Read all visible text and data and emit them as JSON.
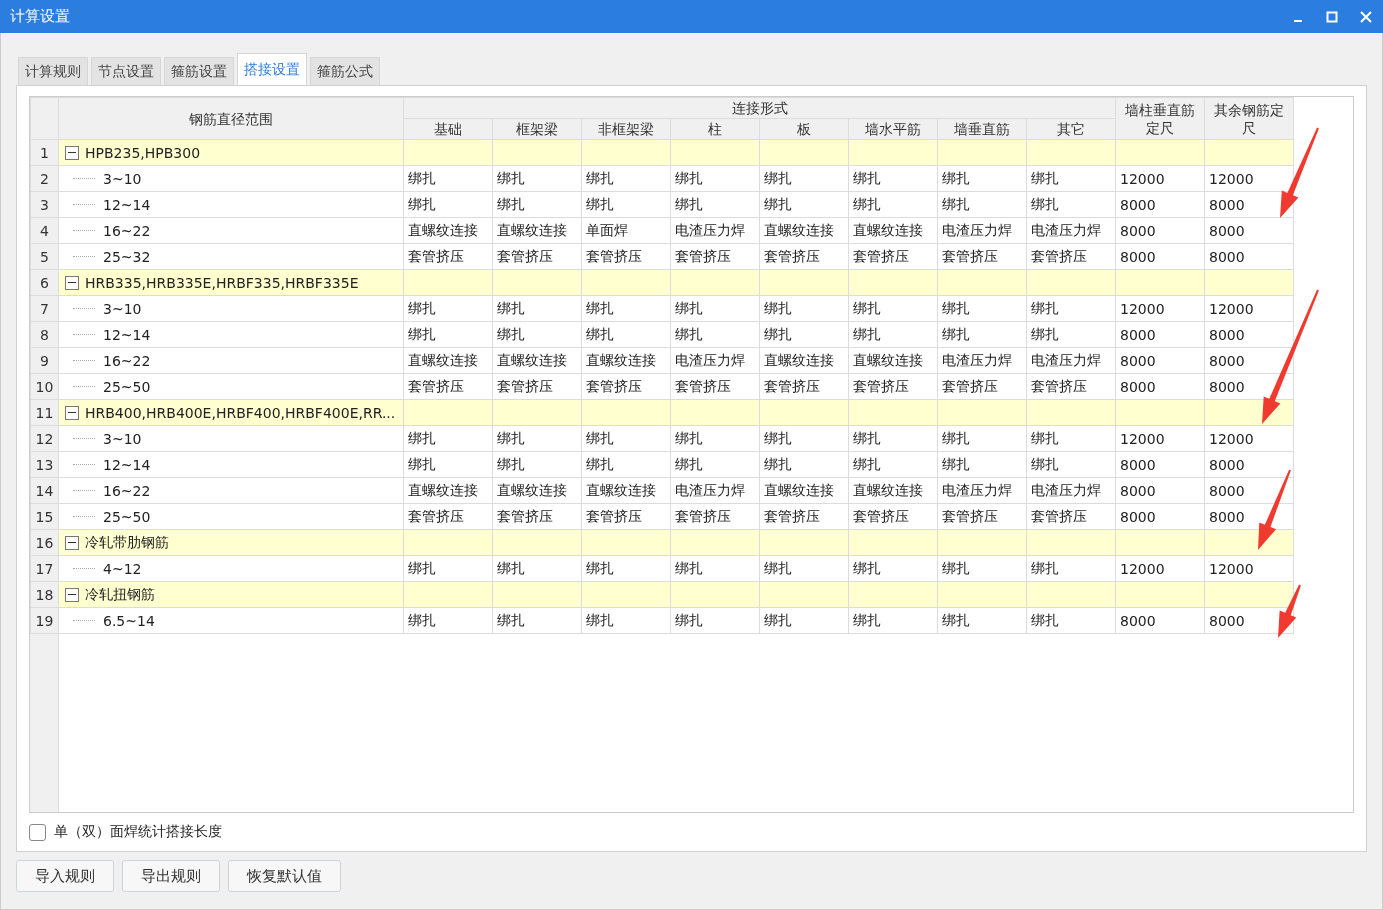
{
  "window": {
    "title": "计算设置"
  },
  "tabs": [
    {
      "label": "计算规则",
      "selected": false
    },
    {
      "label": "节点设置",
      "selected": false
    },
    {
      "label": "箍筋设置",
      "selected": false
    },
    {
      "label": "搭接设置",
      "selected": true
    },
    {
      "label": "箍筋公式",
      "selected": false
    }
  ],
  "table": {
    "range_header": "钢筋直径范围",
    "group_header": "连接形式",
    "columns": [
      "基础",
      "框架梁",
      "非框架梁",
      "柱",
      "板",
      "墙水平筋",
      "墙垂直筋",
      "其它"
    ],
    "length_columns": [
      [
        "墙柱垂直筋",
        "定尺"
      ],
      [
        "其余钢筋定",
        "尺"
      ]
    ],
    "groups": [
      {
        "number": "1",
        "label": "HPB235,HPB300",
        "expanded": true,
        "children": [
          {
            "number": "2",
            "label": "3~10",
            "cells": [
              "绑扎",
              "绑扎",
              "绑扎",
              "绑扎",
              "绑扎",
              "绑扎",
              "绑扎",
              "绑扎",
              "12000",
              "12000"
            ]
          },
          {
            "number": "3",
            "label": "12~14",
            "cells": [
              "绑扎",
              "绑扎",
              "绑扎",
              "绑扎",
              "绑扎",
              "绑扎",
              "绑扎",
              "绑扎",
              "8000",
              "8000"
            ]
          },
          {
            "number": "4",
            "label": "16~22",
            "cells": [
              "直螺纹连接",
              "直螺纹连接",
              "单面焊",
              "电渣压力焊",
              "直螺纹连接",
              "直螺纹连接",
              "电渣压力焊",
              "电渣压力焊",
              "8000",
              "8000"
            ]
          },
          {
            "number": "5",
            "label": "25~32",
            "cells": [
              "套管挤压",
              "套管挤压",
              "套管挤压",
              "套管挤压",
              "套管挤压",
              "套管挤压",
              "套管挤压",
              "套管挤压",
              "8000",
              "8000"
            ]
          }
        ]
      },
      {
        "number": "6",
        "label": "HRB335,HRB335E,HRBF335,HRBF335E",
        "expanded": true,
        "children": [
          {
            "number": "7",
            "label": "3~10",
            "cells": [
              "绑扎",
              "绑扎",
              "绑扎",
              "绑扎",
              "绑扎",
              "绑扎",
              "绑扎",
              "绑扎",
              "12000",
              "12000"
            ]
          },
          {
            "number": "8",
            "label": "12~14",
            "cells": [
              "绑扎",
              "绑扎",
              "绑扎",
              "绑扎",
              "绑扎",
              "绑扎",
              "绑扎",
              "绑扎",
              "8000",
              "8000"
            ]
          },
          {
            "number": "9",
            "label": "16~22",
            "cells": [
              "直螺纹连接",
              "直螺纹连接",
              "直螺纹连接",
              "电渣压力焊",
              "直螺纹连接",
              "直螺纹连接",
              "电渣压力焊",
              "电渣压力焊",
              "8000",
              "8000"
            ]
          },
          {
            "number": "10",
            "label": "25~50",
            "cells": [
              "套管挤压",
              "套管挤压",
              "套管挤压",
              "套管挤压",
              "套管挤压",
              "套管挤压",
              "套管挤压",
              "套管挤压",
              "8000",
              "8000"
            ]
          }
        ]
      },
      {
        "number": "11",
        "label": "HRB400,HRB400E,HRBF400,HRBF400E,RR...",
        "expanded": true,
        "children": [
          {
            "number": "12",
            "label": "3~10",
            "cells": [
              "绑扎",
              "绑扎",
              "绑扎",
              "绑扎",
              "绑扎",
              "绑扎",
              "绑扎",
              "绑扎",
              "12000",
              "12000"
            ]
          },
          {
            "number": "13",
            "label": "12~14",
            "cells": [
              "绑扎",
              "绑扎",
              "绑扎",
              "绑扎",
              "绑扎",
              "绑扎",
              "绑扎",
              "绑扎",
              "8000",
              "8000"
            ]
          },
          {
            "number": "14",
            "label": "16~22",
            "cells": [
              "直螺纹连接",
              "直螺纹连接",
              "直螺纹连接",
              "电渣压力焊",
              "直螺纹连接",
              "直螺纹连接",
              "电渣压力焊",
              "电渣压力焊",
              "8000",
              "8000"
            ]
          },
          {
            "number": "15",
            "label": "25~50",
            "cells": [
              "套管挤压",
              "套管挤压",
              "套管挤压",
              "套管挤压",
              "套管挤压",
              "套管挤压",
              "套管挤压",
              "套管挤压",
              "8000",
              "8000"
            ]
          }
        ]
      },
      {
        "number": "16",
        "label": "冷轧带肋钢筋",
        "expanded": true,
        "children": [
          {
            "number": "17",
            "label": "4~12",
            "cells": [
              "绑扎",
              "绑扎",
              "绑扎",
              "绑扎",
              "绑扎",
              "绑扎",
              "绑扎",
              "绑扎",
              "12000",
              "12000"
            ]
          }
        ]
      },
      {
        "number": "18",
        "label": "冷轧扭钢筋",
        "expanded": true,
        "children": [
          {
            "number": "19",
            "label": "6.5~14",
            "cells": [
              "绑扎",
              "绑扎",
              "绑扎",
              "绑扎",
              "绑扎",
              "绑扎",
              "绑扎",
              "绑扎",
              "8000",
              "8000"
            ]
          }
        ]
      }
    ]
  },
  "option": {
    "label": "单（双）面焊统计搭接长度",
    "checked": false
  },
  "buttons": [
    "导入规则",
    "导出规则",
    "恢复默认值"
  ]
}
